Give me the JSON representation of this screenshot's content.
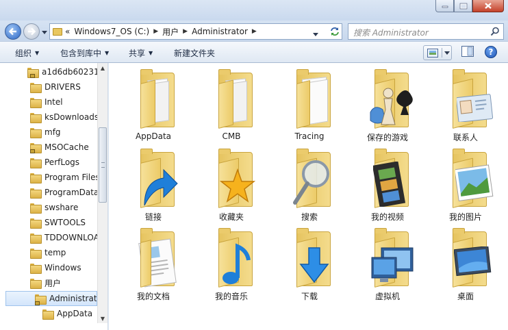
{
  "address": {
    "overflow": "«",
    "crumbs": [
      "Windows7_OS (C:)",
      "用户",
      "Administrator"
    ]
  },
  "search": {
    "placeholder": "搜索 Administrator"
  },
  "toolbar": {
    "organize": "组织",
    "include_in_library": "包含到库中",
    "share": "共享",
    "new_folder": "新建文件夹"
  },
  "sidebar": {
    "items": [
      {
        "label": "a1d6db60231",
        "locked": true
      },
      {
        "label": "DRIVERS",
        "locked": false
      },
      {
        "label": "Intel",
        "locked": false
      },
      {
        "label": "ksDownloads",
        "locked": false
      },
      {
        "label": "mfg",
        "locked": false
      },
      {
        "label": "MSOCache",
        "locked": true
      },
      {
        "label": "PerfLogs",
        "locked": false
      },
      {
        "label": "Program Files",
        "locked": false
      },
      {
        "label": "ProgramData",
        "locked": false
      },
      {
        "label": "swshare",
        "locked": false
      },
      {
        "label": "SWTOOLS",
        "locked": false
      },
      {
        "label": "TDDOWNLOAD",
        "locked": false
      },
      {
        "label": "temp",
        "locked": false
      },
      {
        "label": "Windows",
        "locked": false
      },
      {
        "label": "用户",
        "locked": false
      },
      {
        "label": "Administrator",
        "locked": true,
        "selected": true
      },
      {
        "label": "AppData",
        "locked": false
      }
    ]
  },
  "files": [
    {
      "label": "AppData",
      "icon": "folder-documents-icon"
    },
    {
      "label": "CMB",
      "icon": "folder-documents-icon"
    },
    {
      "label": "Tracing",
      "icon": "folder-papers-icon"
    },
    {
      "label": "保存的游戏",
      "icon": "saved-games-icon"
    },
    {
      "label": "联系人",
      "icon": "contacts-icon"
    },
    {
      "label": "链接",
      "icon": "links-icon"
    },
    {
      "label": "收藏夹",
      "icon": "favorites-icon"
    },
    {
      "label": "搜索",
      "icon": "searches-icon"
    },
    {
      "label": "我的视频",
      "icon": "videos-icon"
    },
    {
      "label": "我的图片",
      "icon": "pictures-icon"
    },
    {
      "label": "我的文档",
      "icon": "documents-icon"
    },
    {
      "label": "我的音乐",
      "icon": "music-icon"
    },
    {
      "label": "下载",
      "icon": "downloads-icon"
    },
    {
      "label": "虚拟机",
      "icon": "virtual-machines-icon"
    },
    {
      "label": "桌面",
      "icon": "desktop-icon"
    }
  ],
  "colors": {
    "folder": "#e9c75f",
    "accent": "#2a65c5",
    "chrome": "#c9d9ee"
  }
}
